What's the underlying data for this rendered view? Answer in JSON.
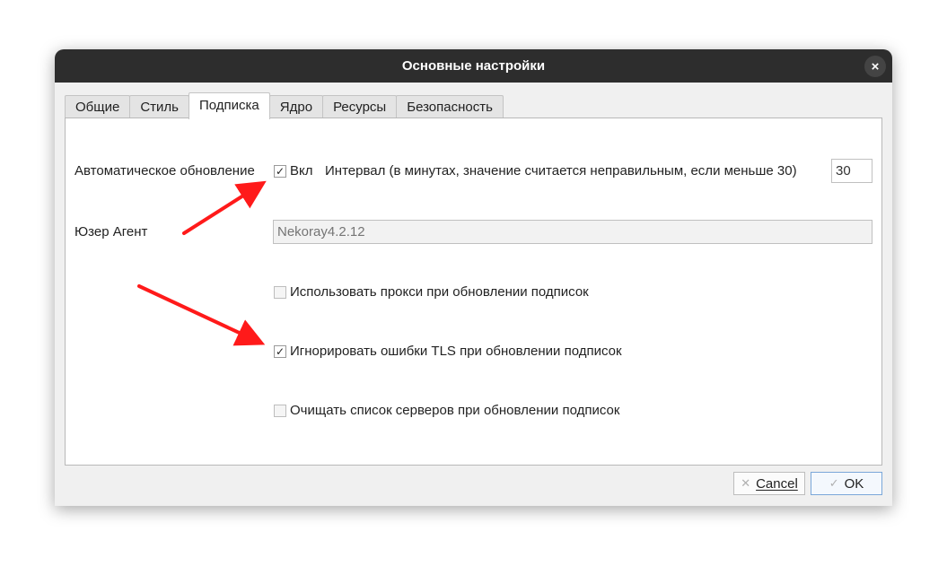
{
  "window": {
    "title": "Основные настройки",
    "close_glyph": "×"
  },
  "tabs": [
    {
      "label": "Общие"
    },
    {
      "label": "Стиль"
    },
    {
      "label": "Подписка",
      "active": true
    },
    {
      "label": "Ядро"
    },
    {
      "label": "Ресурсы"
    },
    {
      "label": "Безопасность"
    }
  ],
  "subscription": {
    "auto_update_label": "Автоматическое обновление",
    "auto_update_checkbox_label": "Вкл",
    "auto_update_checked": true,
    "interval_label": "Интервал (в минутах, значение считается неправильным, если меньше 30)",
    "interval_value": "30",
    "user_agent_label": "Юзер Агент",
    "user_agent_placeholder": "Nekoray4.2.12",
    "use_proxy_label": "Использовать прокси при обновлении подписок",
    "use_proxy_checked": false,
    "ignore_tls_label": "Игнорировать ошибки TLS при обновлении подписок",
    "ignore_tls_checked": true,
    "clear_servers_label": "Очищать список серверов при обновлении подписок",
    "clear_servers_checked": false
  },
  "buttons": {
    "cancel_label": "Cancel",
    "ok_label": "OK"
  },
  "check_glyph": "✓",
  "colors": {
    "annotation_arrow": "#ff1a1a",
    "titlebar": "#2d2d2d",
    "ok_border": "#7aa7d9"
  }
}
